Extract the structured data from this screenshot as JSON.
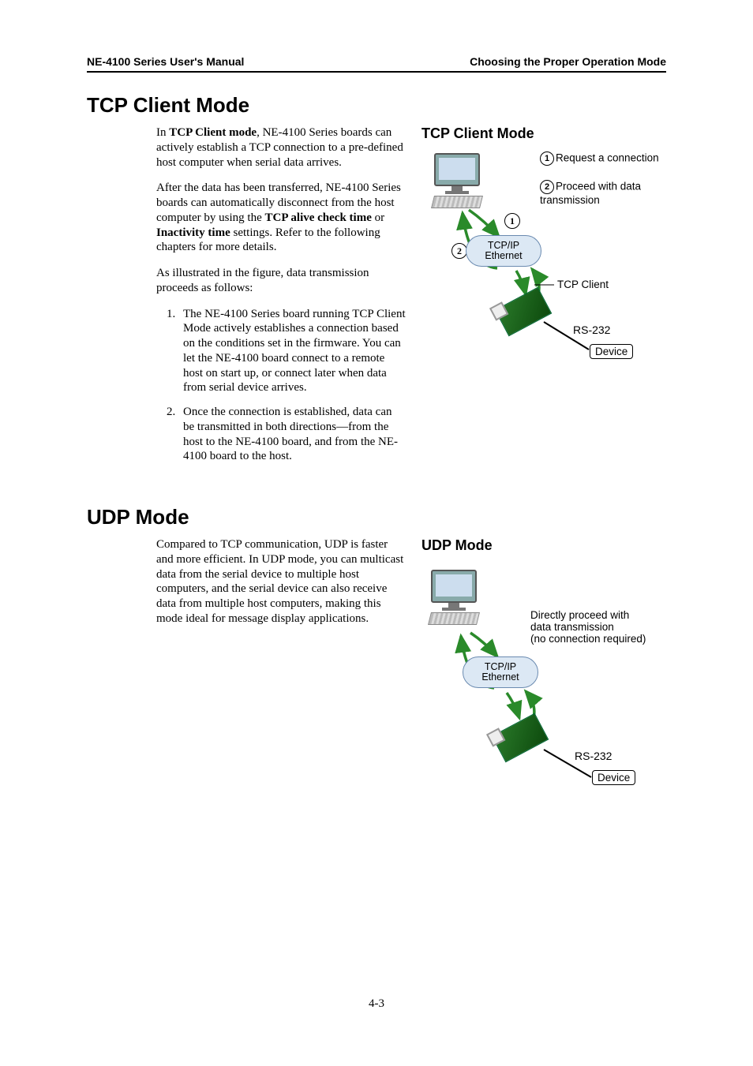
{
  "header": {
    "left": "NE-4100 Series User's Manual",
    "right": "Choosing the Proper Operation Mode"
  },
  "tcp": {
    "heading": "TCP Client Mode",
    "p1_a": "In ",
    "p1_b": "TCP Client mode",
    "p1_c": ", NE-4100 Series boards can actively establish a TCP connection to a pre-defined host computer when serial data arrives.",
    "p2_a": "After the data has been transferred, NE-4100 Series boards can automatically disconnect from the host computer by using the ",
    "p2_b": "TCP alive check time",
    "p2_c": " or ",
    "p2_d": "Inactivity time",
    "p2_e": " settings. Refer to the following chapters for more details.",
    "p3": "As illustrated in the figure, data transmission proceeds as follows:",
    "li1": "The NE-4100 Series board running TCP Client Mode actively establishes a connection based on the conditions set in the firmware. You can let the NE-4100 board connect to a remote host on start up, or connect later when data from serial device arrives.",
    "li2": "Once the connection is established, data can be transmitted in both directions—from the host to the NE-4100 board, and from the NE-4100 board to the host.",
    "fig": {
      "title": "TCP Client Mode",
      "step1": "Request a connection",
      "step2": "Proceed with data transmission",
      "cloud1": "TCP/IP",
      "cloud2": "Ethernet",
      "client": "TCP Client",
      "rs232": "RS-232",
      "device": "Device",
      "n1": "1",
      "n2": "2"
    }
  },
  "udp": {
    "heading": "UDP Mode",
    "p1": "Compared to TCP communication, UDP is faster and more efficient. In UDP mode, you can multicast data from the serial device to multiple host computers, and the serial device can also receive data from multiple host computers, making this mode ideal for message display applications.",
    "fig": {
      "title": "UDP Mode",
      "anno_l1": "Directly proceed with",
      "anno_l2": "data transmission",
      "anno_l3": "(no connection required)",
      "cloud1": "TCP/IP",
      "cloud2": "Ethernet",
      "rs232": "RS-232",
      "device": "Device"
    }
  },
  "page_number": "4-3"
}
